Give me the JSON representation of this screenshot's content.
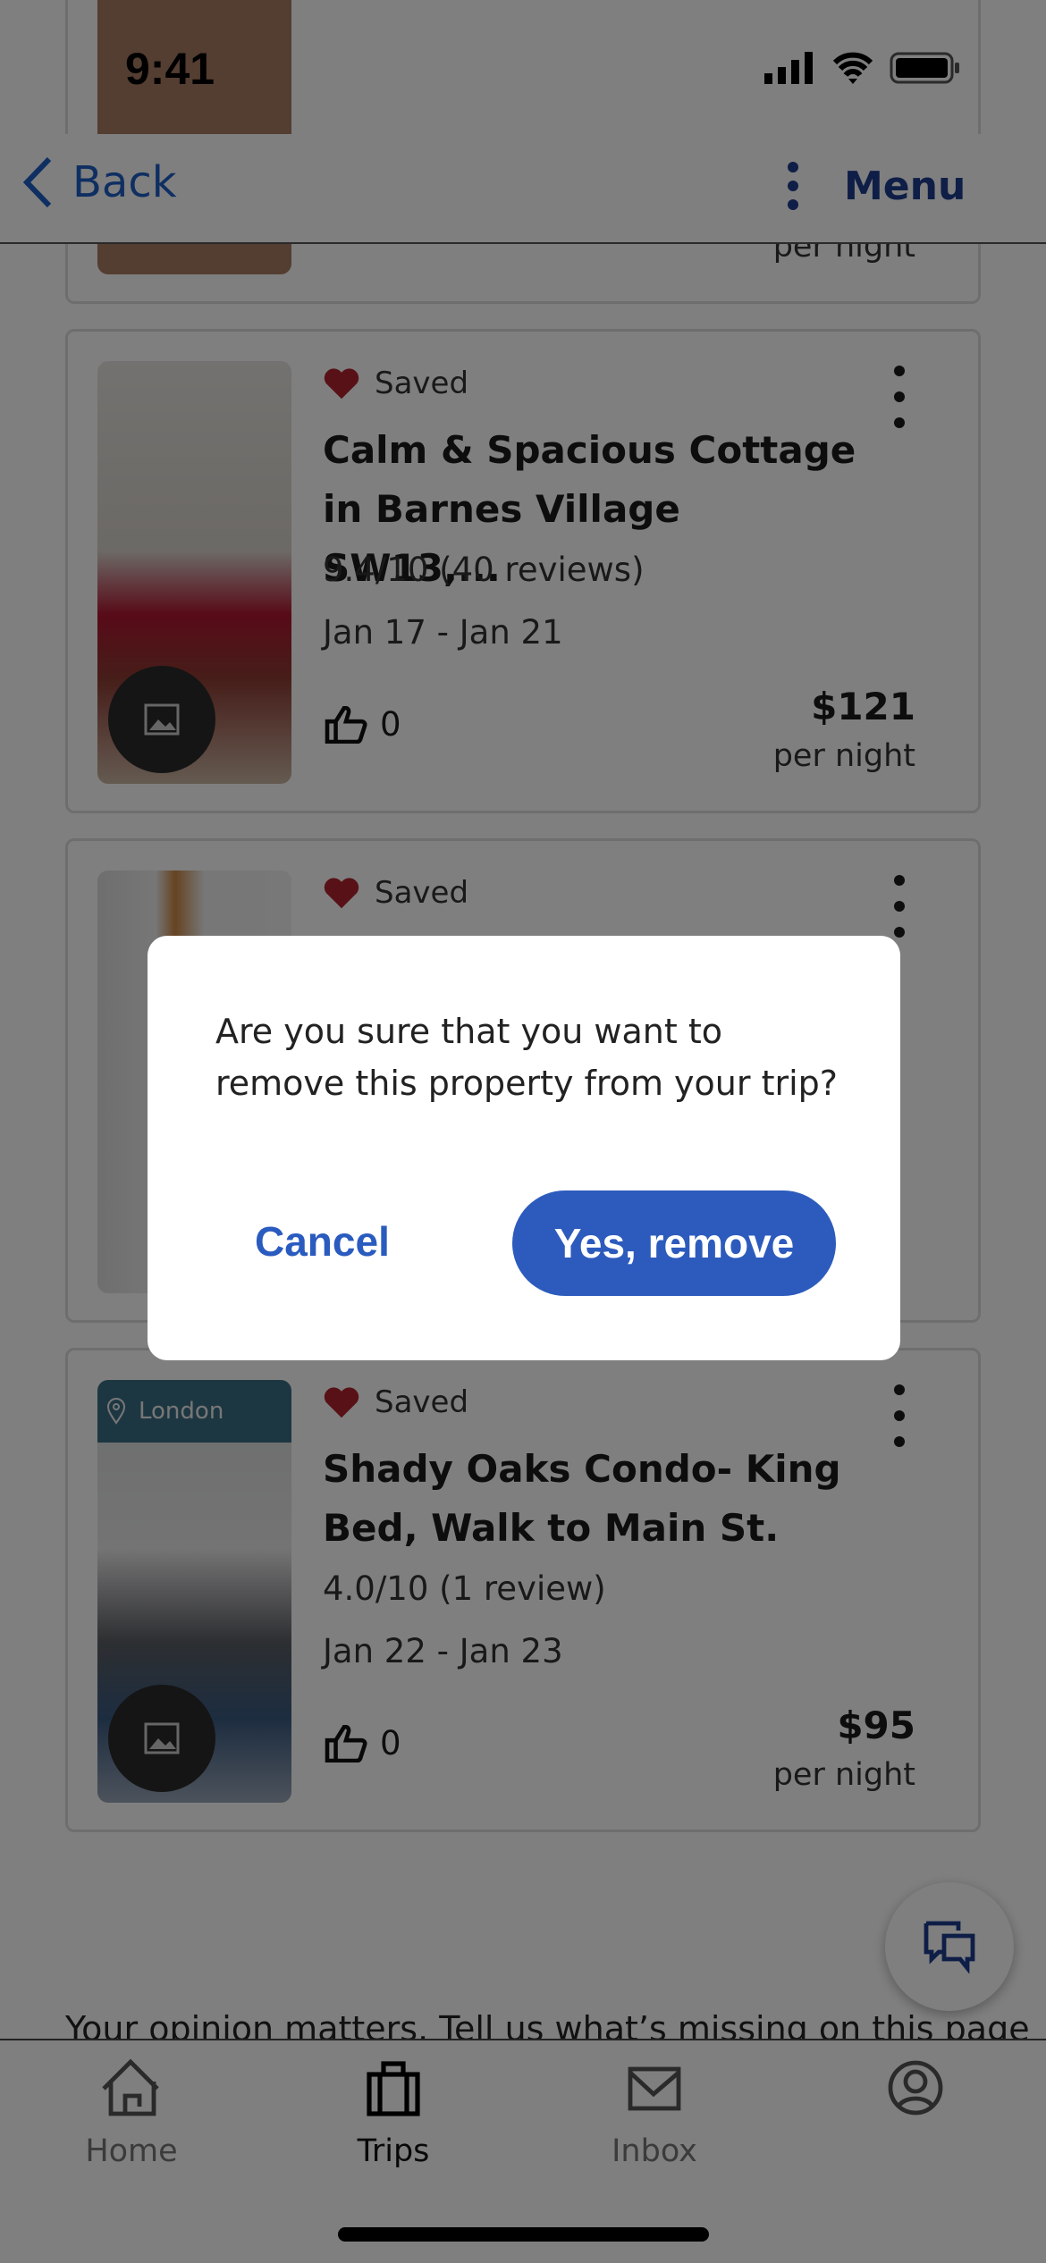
{
  "status": {
    "time": "9:41"
  },
  "nav": {
    "back": "Back",
    "menu": "Menu"
  },
  "cards": [
    {
      "per_night": "per night"
    },
    {
      "saved": "Saved",
      "title": "Calm & Spacious Cottage in Barnes Village SW13,...",
      "rating": "9.4/10 (40 reviews)",
      "dates": "Jan 17 - Jan 21",
      "likes": "0",
      "price": "$121",
      "per_night": "per night"
    },
    {
      "saved": "Saved"
    },
    {
      "saved": "Saved",
      "location": "London",
      "title": "Shady Oaks Condo- King Bed, Walk to Main St.",
      "rating": "4.0/10 (1 review)",
      "dates": "Jan 22 - Jan 23",
      "likes": "0",
      "price": "$95",
      "per_night": "per night"
    }
  ],
  "dialog": {
    "message": "Are you sure that you want to remove this property from your trip?",
    "cancel": "Cancel",
    "confirm": "Yes, remove"
  },
  "feedback": "Your opinion matters. Tell us what’s missing on this page",
  "tabs": [
    {
      "label": "Home",
      "icon": "home-icon"
    },
    {
      "label": "Trips",
      "icon": "briefcase-icon",
      "active": true
    },
    {
      "label": "Inbox",
      "icon": "mail-icon"
    },
    {
      "label": "",
      "icon": "account-icon"
    }
  ],
  "colors": {
    "accent": "#2d5bbd",
    "heart": "#b0222c"
  }
}
